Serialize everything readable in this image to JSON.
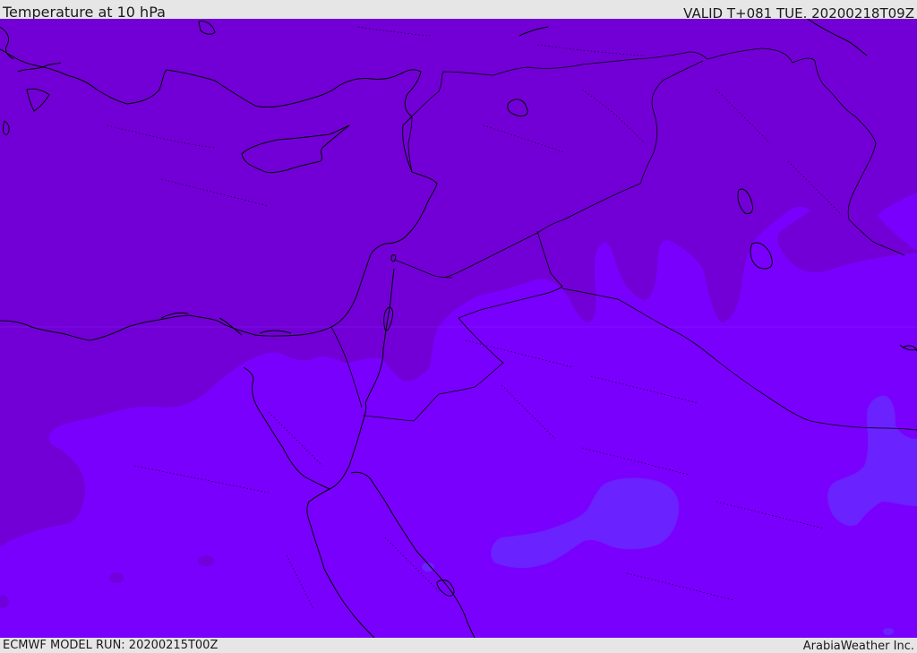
{
  "header": {
    "title": "Temperature at 10 hPa",
    "valid": "VALID T+081 TUE. 20200218T09Z"
  },
  "footer": {
    "model_run": "ECMWF MODEL RUN: 20200215T00Z",
    "credit": "ArabiaWeather Inc."
  },
  "colors": {
    "field_warmer_north": "#7200d6",
    "field_main": "#7a00fd",
    "field_cold_pockets": "#6a22ff",
    "coastline": "#000000",
    "bar_background": "#e6e6e6"
  }
}
